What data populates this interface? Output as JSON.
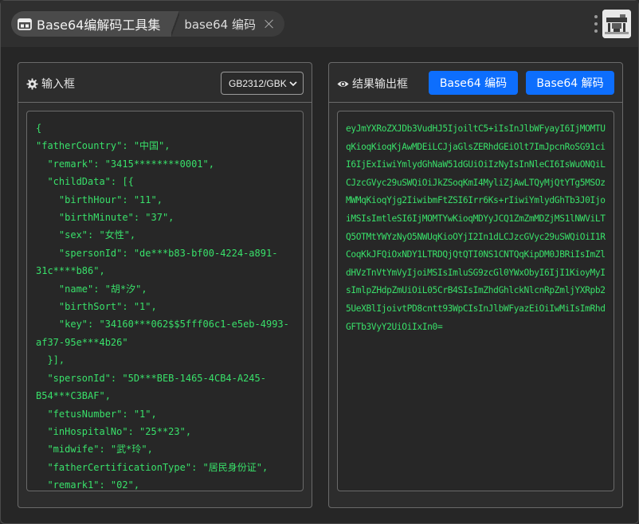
{
  "tabs": {
    "home_label": "Base64编解码工具集",
    "active_label": "base64 编码"
  },
  "input_panel": {
    "title": "输入框",
    "encoding_selected": "GB2312/GBK",
    "lines": [
      "{",
      "\"fatherCountry\": \"中国\",",
      "  \"remark\": \"3415********0001\",",
      "  \"childData\": [{",
      "    \"birthHour\": \"11\",",
      "    \"birthMinute\": \"37\",",
      "    \"sex\": \"女性\",",
      "    \"spersonId\": \"de***b83-bf00-4224-a891-",
      "31c****b86\",",
      "    \"name\": \"胡*汐\",",
      "    \"birthSort\": \"1\",",
      "    \"key\": \"34160***062$$5fff06c1-e5eb-4993-",
      "af37-95e***4b26\"",
      "  }],",
      "  \"spersonId\": \"5D***BEB-1465-4CB4-A245-",
      "B54***C3BAF\",",
      "  \"fetusNumber\": \"1\",",
      "  \"inHospitalNo\": \"25**23\",",
      "  \"midwife\": \"武*玲\",",
      "  \"fatherCertificationType\": \"居民身份证\",",
      "  \"remark1\": \"02\","
    ]
  },
  "output_panel": {
    "title": "结果输出框",
    "encode_button": "Base64 编码",
    "decode_button": "Base64 解码",
    "result": "eyJmYXRoZXJDb3VudHJ5IjoiltC5+iIsInJlbWFyayI6IjMOMTUqKioqKioqKjAwMDEiLCJjaGlsZERhdGEiOlt7ImJpcnRoSG91ciI6IjExIiwiYmlydGhNaW51dGUiOiIzNyIsInNleCI6IsWuONQiLCJzcGVyc29uSWQiOiJkZSoqKmI4MyliZjAwLTQyMjQtYTg5MSOzMWMqKioqYjg2IiwibmFtZSI6Irr6Ks+rIiwiYmlydGhTb3J0IjoiMSIsImtleSI6IjMOMTYwKioqMDYyJCQ1ZmZmMDZjMS1lNWViLTQ5OTMtYWYzNyO5NWUqKioOYjI2In1dLCJzcGVyc29uSWQiOiI1RCoqKkJFQiOxNDY1LTRDQjQtQTI0NS1CNTQqKipDM0JBRiIsImZldHVzTnVtYmVyIjoiMSIsImluSG9zcGl0YWxObyI6IjI1KioyMyIsImlpZHdpZmUiOiL05CrB4SIsImZhdGhlckNlcnRpZmljYXRpb25UeXBlIjoivtPD8cntt93WpCIsInJlbWFyazEiOiIwMiIsImRhdGFTb3VyY2UiOiIxIn0="
  }
}
